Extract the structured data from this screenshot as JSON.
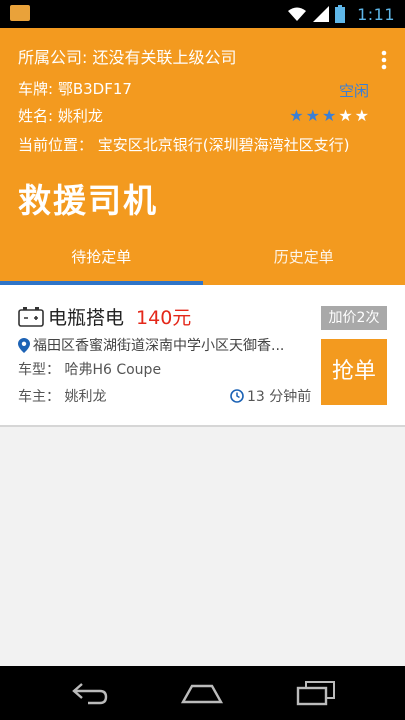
{
  "status_bar": {
    "time": "1:11"
  },
  "header": {
    "company_label": "所属公司:",
    "company_value": "还没有关联上级公司",
    "plate_label": "车牌:",
    "plate_value": "鄂B3DF17",
    "status": "空闲",
    "name_label": "姓名:",
    "name_value": "姚利龙",
    "rating": {
      "filled": 3,
      "total": 5
    },
    "location_label": "当前位置：",
    "location_value": "宝安区北京银行(深圳碧海湾社区支行)",
    "role_title": "救援司机"
  },
  "tabs": [
    {
      "label": "待抢定单",
      "active": true
    },
    {
      "label": "历史定单",
      "active": false
    }
  ],
  "order": {
    "service_name": "电瓶搭电",
    "price": "140元",
    "raise_badge": "加价2次",
    "address": "福田区香蜜湖街道深南中学小区天御香...",
    "car_label": "车型：",
    "car_value": "哈弗H6 Coupe",
    "owner_label": "车主：",
    "owner_value": "姚利龙",
    "time_ago": "13 分钟前",
    "grab_label": "抢单"
  },
  "colors": {
    "accent": "#f39a1f",
    "tab_indicator": "#2f74c7",
    "price": "#e4281a",
    "status_idle": "#3a7fd6"
  }
}
